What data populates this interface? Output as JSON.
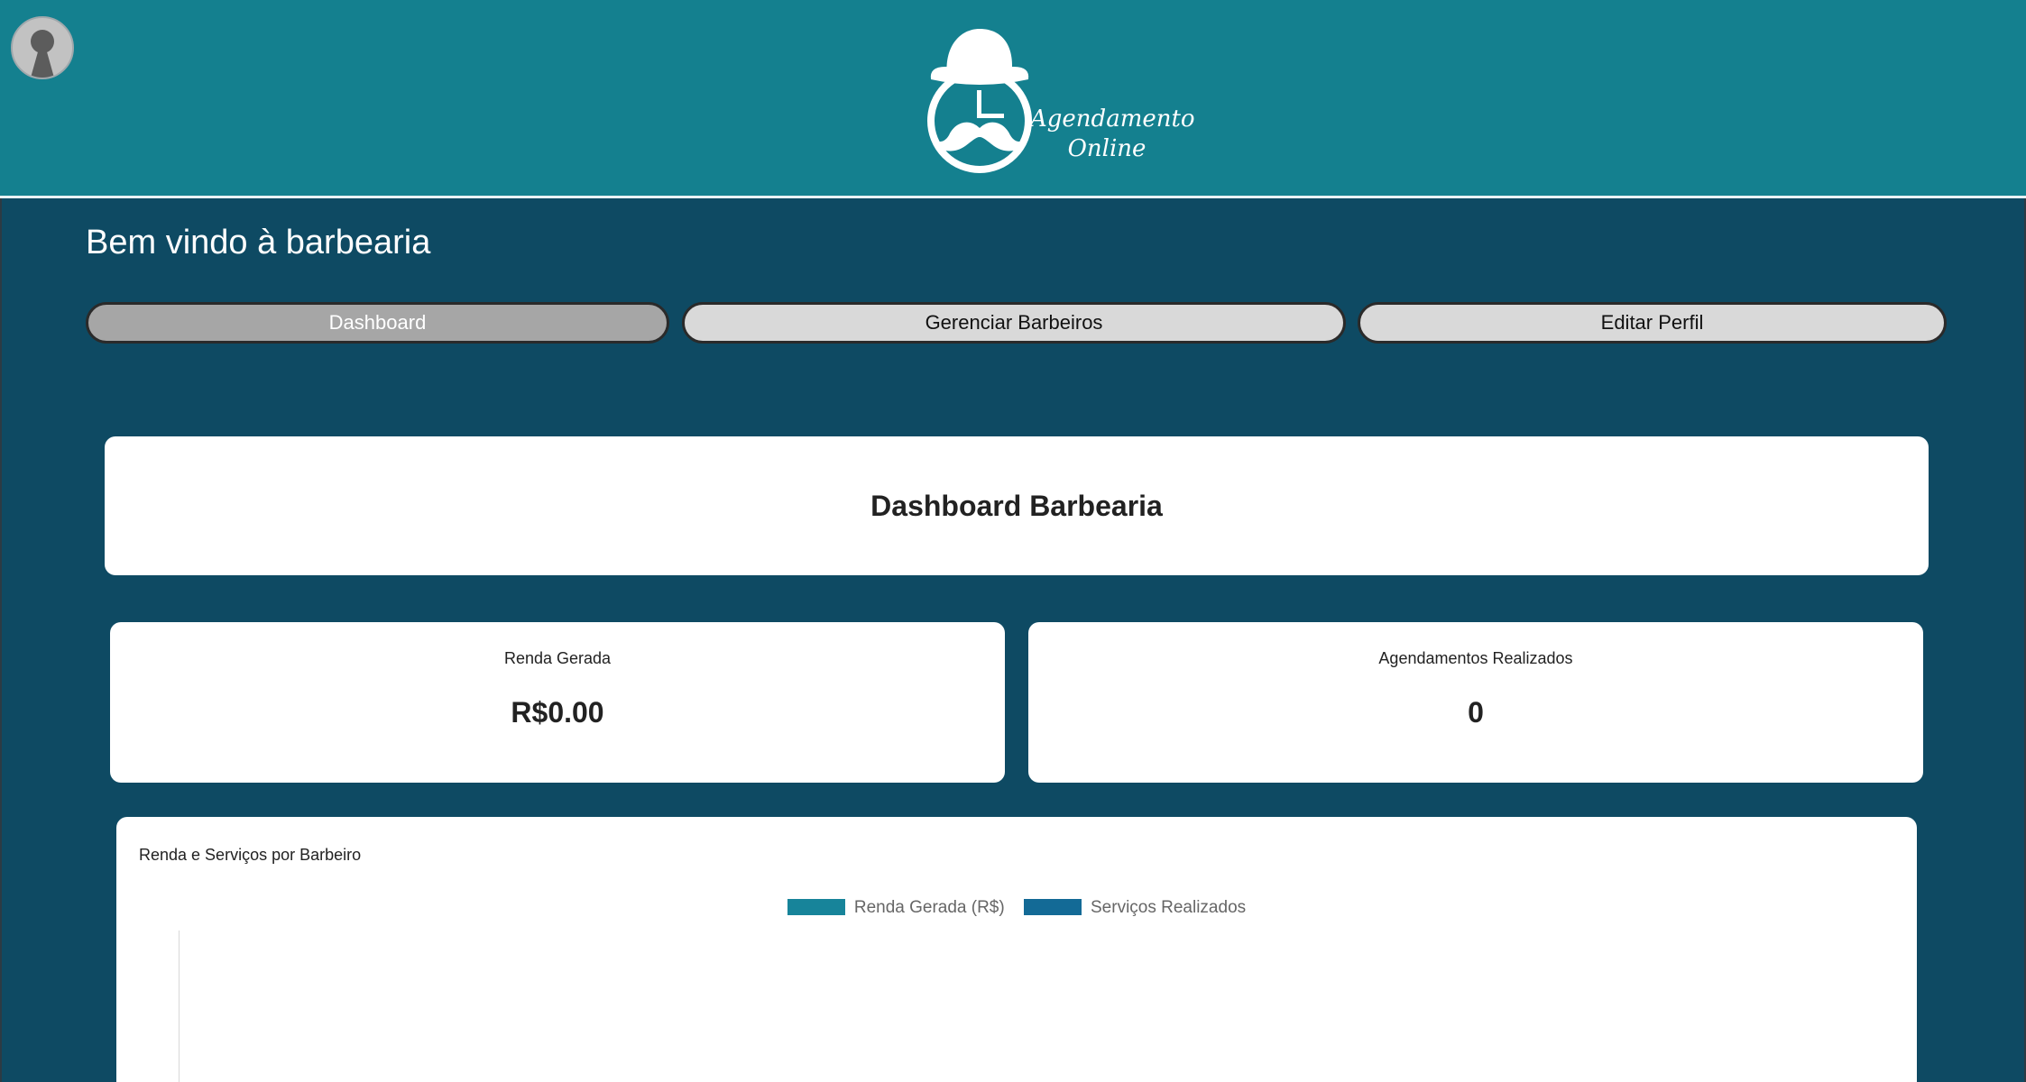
{
  "header": {
    "logo_line1": "Agendamento",
    "logo_line2": "Online",
    "avatar_icon": "user-silhouette-icon",
    "logo_icon": "barber-bowler-hat-mustache-icon"
  },
  "welcome_title": "Bem vindo à barbearia",
  "tabs": [
    {
      "label": "Dashboard",
      "active": true
    },
    {
      "label": "Gerenciar Barbeiros",
      "active": false
    },
    {
      "label": "Editar Perfil",
      "active": false
    }
  ],
  "dashboard": {
    "title": "Dashboard Barbearia",
    "stats": [
      {
        "label": "Renda Gerada",
        "value": "R$0.00"
      },
      {
        "label": "Agendamentos Realizados",
        "value": "0"
      }
    ]
  },
  "chart_data": {
    "type": "bar",
    "title": "Renda e Serviços por Barbeiro",
    "categories": [],
    "series": [
      {
        "name": "Renda Gerada (R$)",
        "values": [],
        "color": "#17849a"
      },
      {
        "name": "Serviços Realizados",
        "values": [],
        "color": "#136a96"
      }
    ],
    "legend": "top-center"
  },
  "colors": {
    "header": "#14808f",
    "background": "#0e4a63",
    "tab_active": "#a6a6a6",
    "tab_inactive": "#d9d9d9"
  }
}
